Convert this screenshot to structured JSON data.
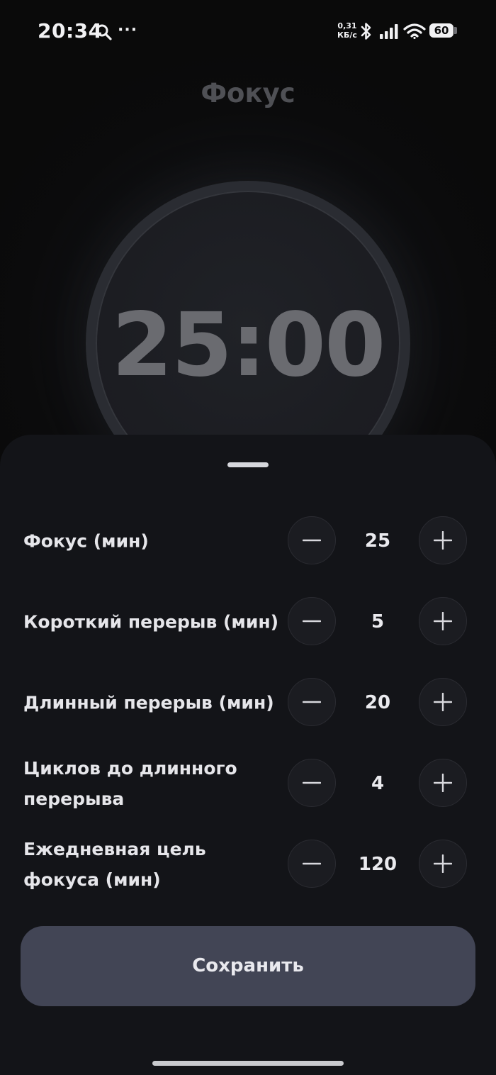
{
  "status_bar": {
    "time": "20:34",
    "more_dots": "···",
    "net_speed_value": "0,31",
    "net_speed_unit": "КБ/с",
    "battery": "60",
    "icons": [
      "search-icon",
      "bluetooth-icon",
      "signal-icon",
      "wifi-icon",
      "battery-icon"
    ]
  },
  "page": {
    "title": "Фокус",
    "timer": "25:00"
  },
  "settings": {
    "items": [
      {
        "label": "Фокус (мин)",
        "value": "25"
      },
      {
        "label": "Короткий перерыв (мин)",
        "value": "5"
      },
      {
        "label": "Длинный перерыв (мин)",
        "value": "20"
      },
      {
        "label": "Циклов до длинного перерыва",
        "value": "4"
      },
      {
        "label": "Ежедневная цель фокуса (мин)",
        "value": "120"
      }
    ],
    "decrement_icon": "minus-icon",
    "increment_icon": "plus-icon",
    "save_label": "Сохранить"
  },
  "colors": {
    "background": "#0b0b0c",
    "sheet": "#131418",
    "save_button": "#424555",
    "timer_text": "#6a6b70",
    "title_text": "#4f5055"
  }
}
